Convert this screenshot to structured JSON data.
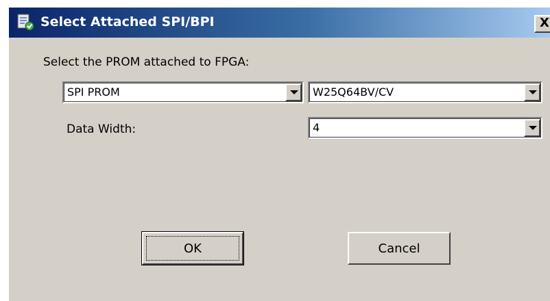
{
  "dialog": {
    "title": "Select Attached SPI/BPI",
    "close_label": "X"
  },
  "prompt_label": "Select the PROM attached to FPGA:",
  "prom_type": {
    "selected": "SPI PROM"
  },
  "prom_part": {
    "selected": "W25Q64BV/CV"
  },
  "data_width": {
    "label": "Data Width:",
    "selected": "4"
  },
  "buttons": {
    "ok_label": "OK",
    "cancel_label": "Cancel"
  },
  "colors": {
    "dialog_bg": "#d4d0c8",
    "titlebar_start": "#0a246a",
    "titlebar_end": "#a6caf0"
  }
}
